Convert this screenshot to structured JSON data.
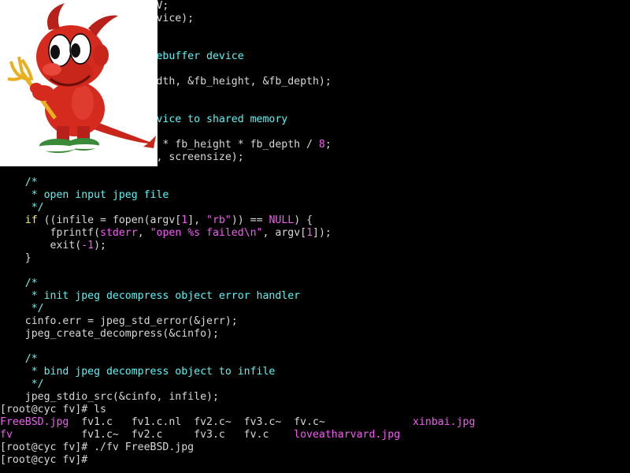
{
  "terminal": {
    "lines": [
      {
        "segs": [
          {
            "c": "ws",
            "t": "                         V;"
          }
        ]
      },
      {
        "segs": [
          {
            "c": "ws",
            "t": "                         vice);"
          }
        ]
      },
      {
        "segs": []
      },
      {
        "segs": []
      },
      {
        "segs": [
          {
            "c": "cm",
            "t": "                         ebuffer device"
          }
        ]
      },
      {
        "segs": []
      },
      {
        "segs": [
          {
            "c": "ws",
            "t": "                         dth, &fb_height, &fb_depth);"
          }
        ]
      },
      {
        "segs": []
      },
      {
        "segs": []
      },
      {
        "segs": [
          {
            "c": "cm",
            "t": "                         vice to shared memory"
          }
        ]
      },
      {
        "segs": []
      },
      {
        "segs": [
          {
            "c": "ws",
            "t": "                          * fb_height * fb_depth / "
          },
          {
            "c": "nm",
            "t": "8"
          },
          {
            "c": "ws",
            "t": ";"
          }
        ]
      },
      {
        "segs": [
          {
            "c": "ws",
            "t": "                         , screensize);"
          }
        ]
      },
      {
        "segs": []
      },
      {
        "segs": [
          {
            "c": "cm",
            "t": "    /*"
          }
        ]
      },
      {
        "segs": [
          {
            "c": "cm",
            "t": "     * open input jpeg file"
          }
        ]
      },
      {
        "segs": [
          {
            "c": "cm",
            "t": "     */"
          }
        ]
      },
      {
        "segs": [
          {
            "c": "kw",
            "t": "    if"
          },
          {
            "c": "ws",
            "t": " ((infile = fopen(argv["
          },
          {
            "c": "nm",
            "t": "1"
          },
          {
            "c": "ws",
            "t": "], "
          },
          {
            "c": "st",
            "t": "\"rb\""
          },
          {
            "c": "ws",
            "t": ")) == "
          },
          {
            "c": "nm",
            "t": "NULL"
          },
          {
            "c": "ws",
            "t": ") {"
          }
        ]
      },
      {
        "segs": [
          {
            "c": "ws",
            "t": "        fprintf("
          },
          {
            "c": "nm",
            "t": "stderr"
          },
          {
            "c": "ws",
            "t": ", "
          },
          {
            "c": "st",
            "t": "\"open %s failed\\n\""
          },
          {
            "c": "ws",
            "t": ", argv["
          },
          {
            "c": "nm",
            "t": "1"
          },
          {
            "c": "ws",
            "t": "]);"
          }
        ]
      },
      {
        "segs": [
          {
            "c": "ws",
            "t": "        exit("
          },
          {
            "c": "nm",
            "t": "-1"
          },
          {
            "c": "ws",
            "t": ");"
          }
        ]
      },
      {
        "segs": [
          {
            "c": "ws",
            "t": "    }"
          }
        ]
      },
      {
        "segs": []
      },
      {
        "segs": [
          {
            "c": "cm",
            "t": "    /*"
          }
        ]
      },
      {
        "segs": [
          {
            "c": "cm",
            "t": "     * init jpeg decompress object error handler"
          }
        ]
      },
      {
        "segs": [
          {
            "c": "cm",
            "t": "     */"
          }
        ]
      },
      {
        "segs": [
          {
            "c": "ws",
            "t": "    cinfo.err = jpeg_std_error(&jerr);"
          }
        ]
      },
      {
        "segs": [
          {
            "c": "ws",
            "t": "    jpeg_create_decompress(&cinfo);"
          }
        ]
      },
      {
        "segs": []
      },
      {
        "segs": [
          {
            "c": "cm",
            "t": "    /*"
          }
        ]
      },
      {
        "segs": [
          {
            "c": "cm",
            "t": "     * bind jpeg decompress object to infile"
          }
        ]
      },
      {
        "segs": [
          {
            "c": "cm",
            "t": "     */"
          }
        ]
      },
      {
        "segs": [
          {
            "c": "ws",
            "t": "    jpeg_stdio_src(&cinfo, infile);"
          }
        ]
      },
      {
        "segs": [
          {
            "c": "ws",
            "t": "[root@cyc fv]# ls"
          }
        ]
      },
      {
        "segs": [
          {
            "c": "mg",
            "t": "FreeBSD.jpg"
          },
          {
            "c": "ws",
            "t": "  fv1.c   fv1.c.nl  fv2.c~  fv3.c~  fv.c~              "
          },
          {
            "c": "mg",
            "t": "xinbai.jpg"
          }
        ]
      },
      {
        "segs": [
          {
            "c": "mg",
            "t": "fv"
          },
          {
            "c": "ws",
            "t": "           fv1.c~  fv2.c     fv3.c   fv.c    "
          },
          {
            "c": "mg",
            "t": "loveatharvard.jpg"
          }
        ]
      },
      {
        "segs": [
          {
            "c": "ws",
            "t": "[root@cyc fv]# ./fv FreeBSD.jpg"
          }
        ]
      },
      {
        "segs": [
          {
            "c": "ws",
            "t": "[root@cyc fv]# "
          },
          {
            "c": "ws",
            "t": ""
          }
        ]
      }
    ]
  },
  "overlay": {
    "image_name": "freebsd-beastie-mascot",
    "colors": {
      "body": "#d52a1e",
      "body_dark": "#8a1410",
      "shoe": "#3a8a3a",
      "trident": "#e8b020"
    }
  },
  "colors": {
    "background": "#000000",
    "text": "#d8d8d8",
    "comment": "#5cf4f4",
    "keyword": "#f4f45c",
    "literal": "#f45cf4"
  }
}
